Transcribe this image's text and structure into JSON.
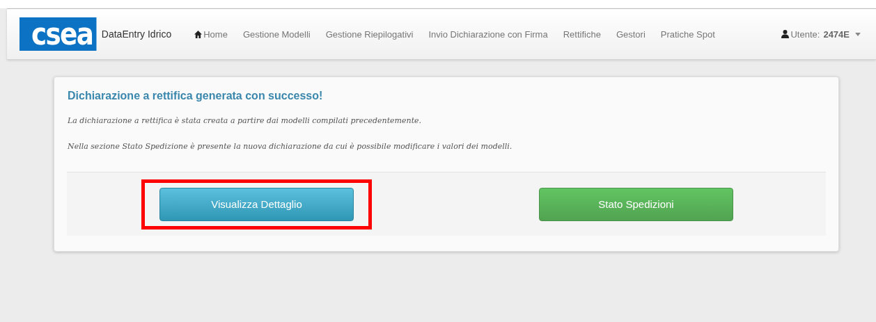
{
  "navbar": {
    "logo": "csea",
    "brand": "DataEntry Idrico",
    "items": [
      {
        "label": "Home",
        "kind": "home"
      },
      {
        "label": "Gestione Modelli"
      },
      {
        "label": "Gestione Riepilogativi"
      },
      {
        "label": "Invio Dichiarazione con Firma"
      },
      {
        "label": "Rettifiche"
      },
      {
        "label": "Gestori"
      },
      {
        "label": "Pratiche Spot"
      }
    ],
    "user": {
      "label": "Utente:",
      "code": "2474E"
    }
  },
  "panel": {
    "title": "Dichiarazione a rettifica generata con successo!",
    "paragraphs": [
      "La dichiarazione a rettifica è stata creata a partire dai modelli compilati precedentemente.",
      "Nella sezione Stato Spedizione è presente la nuova dichiarazione da cui è possibile modificare i valori dei modelli."
    ],
    "buttons": [
      {
        "label": "Visualizza Dettaglio",
        "kind": "info",
        "highlighted": true
      },
      {
        "label": "Stato Spedizioni",
        "kind": "success",
        "highlighted": false
      }
    ]
  }
}
